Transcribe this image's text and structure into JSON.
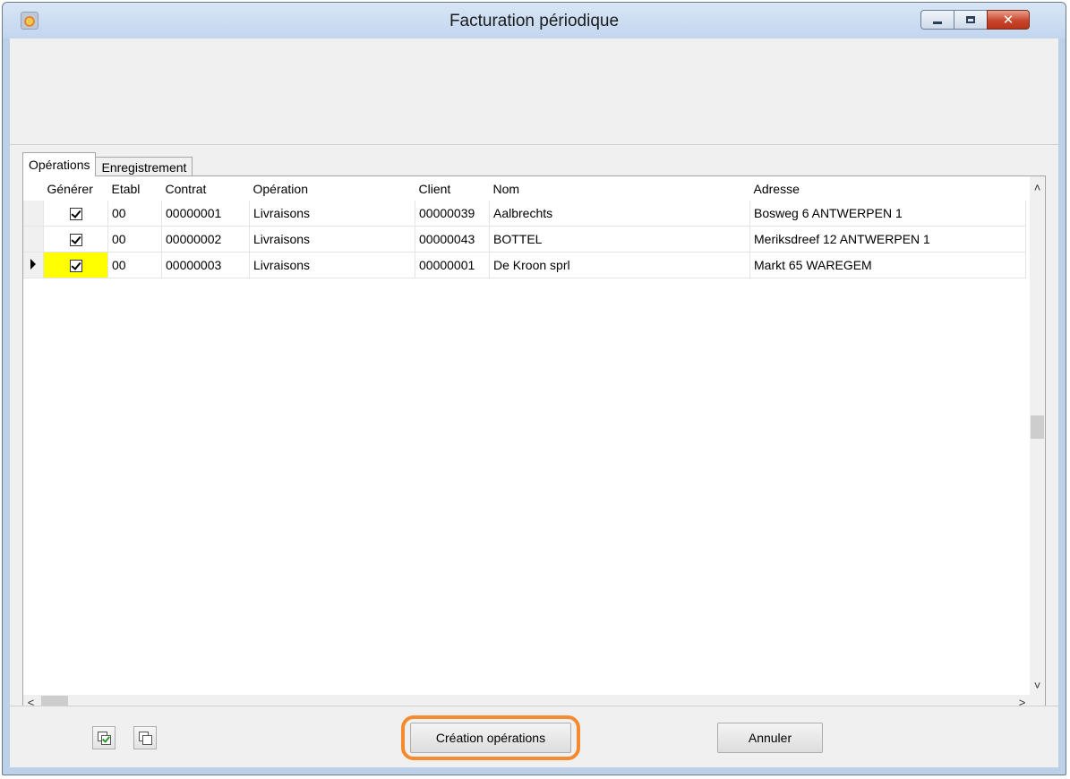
{
  "window": {
    "title": "Facturation périodique",
    "close_glyph": "✕",
    "icon": "app-icon",
    "accent_color": "#c9462c"
  },
  "tabs": [
    {
      "label": "Opérations",
      "active": true
    },
    {
      "label": "Enregistrement",
      "active": false
    }
  ],
  "grid": {
    "columns": [
      "Générer",
      "Etabl",
      "Contrat",
      "Opération",
      "Client",
      "Nom",
      "Adresse"
    ],
    "rows": [
      {
        "generer": true,
        "etabl": "00",
        "contrat": "00000001",
        "operation": "Livraisons",
        "client": "00000039",
        "nom": "Aalbrechts",
        "adresse": "Bosweg 6 ANTWERPEN 1",
        "current": false
      },
      {
        "generer": true,
        "etabl": "00",
        "contrat": "00000002",
        "operation": "Livraisons",
        "client": "00000043",
        "nom": "BOTTEL",
        "adresse": "Meriksdreef 12 ANTWERPEN 1",
        "current": false
      },
      {
        "generer": true,
        "etabl": "00",
        "contrat": "00000003",
        "operation": "Livraisons",
        "client": "00000001",
        "nom": "De Kroon sprl",
        "adresse": "Markt 65 WAREGEM",
        "current": true
      }
    ],
    "current_row_color": "#ffff00"
  },
  "scrollbar": {
    "up": "˄",
    "down": "˅",
    "left": "<",
    "right": ">"
  },
  "footer": {
    "select_all_icon": "select-all-icon",
    "deselect_all_icon": "deselect-all-icon",
    "create_label": "Création opérations",
    "cancel_label": "Annuler",
    "highlight_color": "#f58a2e"
  }
}
